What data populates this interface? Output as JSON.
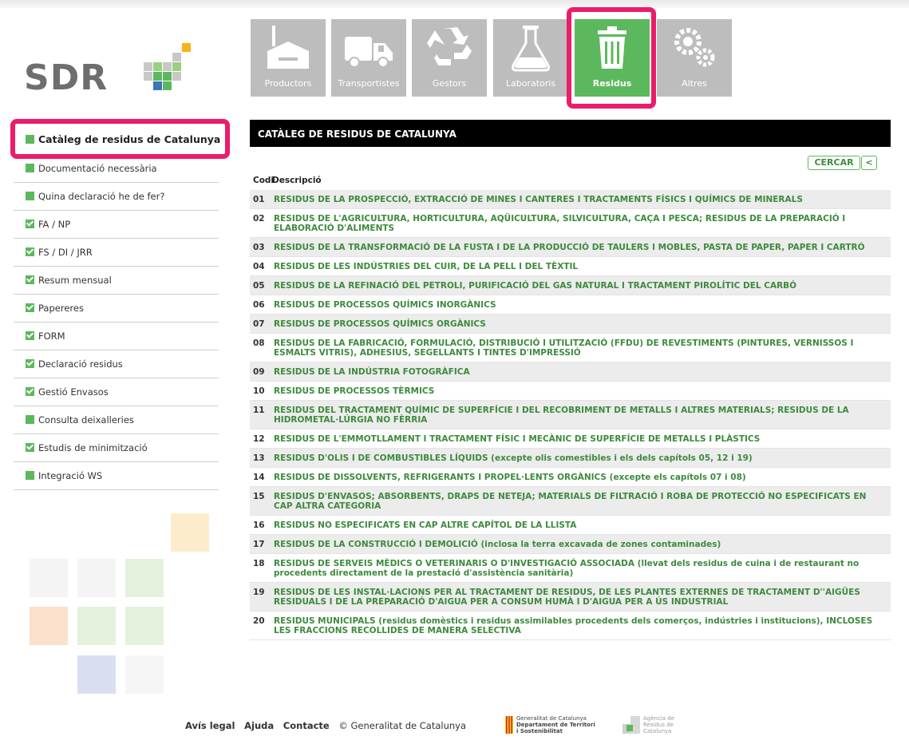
{
  "logo": {
    "text": "SDR"
  },
  "nav": {
    "items": [
      {
        "label": "Productors",
        "icon": "factory-icon"
      },
      {
        "label": "Transportistes",
        "icon": "truck-icon"
      },
      {
        "label": "Gestors",
        "icon": "recycle-icon"
      },
      {
        "label": "Laboratoris",
        "icon": "flask-icon"
      },
      {
        "label": "Residus",
        "icon": "trash-icon",
        "active": true
      },
      {
        "label": "Altres",
        "icon": "gears-icon"
      }
    ]
  },
  "sidebar": {
    "items": [
      {
        "label": "Catàleg de residus de Catalunya",
        "check": false,
        "active": true
      },
      {
        "label": "Documentació necessària",
        "check": false
      },
      {
        "label": "Quina declaració he de fer?",
        "check": false
      },
      {
        "label": "FA / NP",
        "check": true
      },
      {
        "label": "FS / DI / JRR",
        "check": true
      },
      {
        "label": "Resum mensual",
        "check": true
      },
      {
        "label": "Papereres",
        "check": true
      },
      {
        "label": "FORM",
        "check": true
      },
      {
        "label": "Declaració residus",
        "check": true
      },
      {
        "label": "Gestió Envasos",
        "check": true
      },
      {
        "label": "Consulta deixalleries",
        "check": false
      },
      {
        "label": "Estudis de minimització",
        "check": true
      },
      {
        "label": "Integració WS",
        "check": false
      }
    ]
  },
  "main": {
    "title": "CATÀLEG DE RESIDUS DE CATALUNYA",
    "search_label": "CERCAR",
    "back_label": "<",
    "col_code": "Codi",
    "col_desc": "Descripció",
    "rows": [
      {
        "code": "01",
        "desc": "RESIDUS DE LA PROSPECCIÓ, EXTRACCIÓ DE MINES I CANTERES I TRACTAMENTS FÍSICS I QUÍMICS DE MINERALS"
      },
      {
        "code": "02",
        "desc": "RESIDUS DE L'AGRICULTURA, HORTICULTURA, AQÜICULTURA, SILVICULTURA, CAÇA I PESCA; RESIDUS DE LA PREPARACIÓ I ELABORACIÓ D'ALIMENTS"
      },
      {
        "code": "03",
        "desc": "RESIDUS DE LA TRANSFORMACIÓ DE LA FUSTA I DE LA PRODUCCIÓ DE TAULERS I MOBLES, PASTA DE PAPER, PAPER I CARTRÓ"
      },
      {
        "code": "04",
        "desc": "RESIDUS DE LES INDÚSTRIES DEL CUIR, DE LA PELL I DEL TÈXTIL"
      },
      {
        "code": "05",
        "desc": "RESIDUS DE LA REFINACIÓ DEL PETROLI, PURIFICACIÓ DEL GAS NATURAL I TRACTAMENT PIROLÍTIC DEL CARBÓ"
      },
      {
        "code": "06",
        "desc": "RESIDUS DE PROCESSOS QUÍMICS INORGÀNICS"
      },
      {
        "code": "07",
        "desc": "RESIDUS DE PROCESSOS QUÍMICS ORGÀNICS"
      },
      {
        "code": "08",
        "desc": "RESIDUS DE LA FABRICACIÓ, FORMULACIÓ, DISTRIBUCIÓ I UTILITZACIÓ (FFDU) DE REVESTIMENTS (PINTURES, VERNISSOS I ESMALTS VITRIS), ADHESIUS, SEGELLANTS I TINTES D'IMPRESSIÓ"
      },
      {
        "code": "09",
        "desc": "RESIDUS DE LA INDÚSTRIA FOTOGRÀFICA"
      },
      {
        "code": "10",
        "desc": "RESIDUS DE PROCESSOS TÈRMICS"
      },
      {
        "code": "11",
        "desc": "RESIDUS DEL TRACTAMENT QUÍMIC DE SUPERFÍCIE I DEL RECOBRIMENT DE METALLS I ALTRES MATERIALS; RESIDUS DE LA HIDROMETAL·LÚRGIA NO FÈRRIA"
      },
      {
        "code": "12",
        "desc": "RESIDUS DE L'EMMOTLLAMENT I TRACTAMENT FÍSIC I MECÀNIC DE SUPERFÍCIE DE METALLS I PLÀSTICS"
      },
      {
        "code": "13",
        "desc": "RESIDUS D'OLIS I DE COMBUSTIBLES LÍQUIDS (excepte olis comestibles i els dels capítols 05, 12 i 19)"
      },
      {
        "code": "14",
        "desc": "RESIDUS DE DISSOLVENTS, REFRIGERANTS I PROPEL·LENTS ORGÀNICS (excepte els capítols 07 i 08)"
      },
      {
        "code": "15",
        "desc": "RESIDUS D'ENVASOS; ABSORBENTS, DRAPS DE NETEJA; MATERIALS DE FILTRACIÓ I ROBA DE PROTECCIÓ NO ESPECIFICATS EN CAP ALTRA CATEGORIA"
      },
      {
        "code": "16",
        "desc": "RESIDUS NO ESPECIFICATS EN CAP ALTRE CAPÍTOL DE LA LLISTA"
      },
      {
        "code": "17",
        "desc": "RESIDUS DE LA CONSTRUCCIÓ I DEMOLICIÓ (inclosa la terra excavada de zones contaminades)"
      },
      {
        "code": "18",
        "desc": "RESIDUS DE SERVEIS MÈDICS O VETERINARIS O D'INVESTIGACIÓ ASSOCIADA (llevat dels residus de cuina i de restaurant no procedents directament de la prestació d'assistència sanitària)"
      },
      {
        "code": "19",
        "desc": "RESIDUS DE LES INSTAL·LACIONS PER AL TRACTAMENT DE RESIDUS, DE LES PLANTES EXTERNES DE TRACTAMENT D''AIGÜES RESIDUALS I DE LA PREPARACIÓ D'AIGUA PER A CONSUM HUMÀ I D'AIGUA PER A ÚS INDUSTRIAL"
      },
      {
        "code": "20",
        "desc": "RESIDUS MUNICIPALS (residus domèstics i residus assimilables procedents dels comerços, indústries i institucions), INCLOSES LES FRACCIONS RECOLLIDES DE MANERA SELECTIVA"
      }
    ]
  },
  "footer": {
    "legal": "Avís legal",
    "help": "Ajuda",
    "contact": "Contacte",
    "copyright": "© Generalitat de Catalunya",
    "gen_line1": "Generalitat de Catalunya",
    "gen_line2": "Departament de Territori",
    "gen_line3": "i Sostenibilitat",
    "arc_line1": "Agència de",
    "arc_line2": "Residus de",
    "arc_line3": "Catalunya"
  },
  "colors": {
    "green": "#5cb85c",
    "highlight": "#ec1c69",
    "nav_grey": "#bdbdbd"
  }
}
